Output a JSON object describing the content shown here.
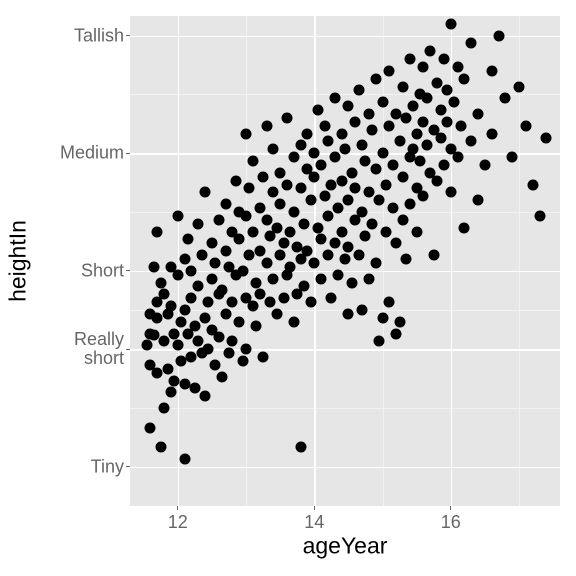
{
  "chart_data": {
    "type": "scatter",
    "title": "",
    "xlabel": "ageYear",
    "ylabel": "heightIn",
    "xlim": [
      11.3,
      17.6
    ],
    "ylim": [
      48,
      73
    ],
    "x_ticks": [
      12,
      14,
      16
    ],
    "y_ticks": [
      {
        "value": 50,
        "label": "Tiny"
      },
      {
        "value": 56,
        "label": "Really\nshort"
      },
      {
        "value": 60,
        "label": "Short"
      },
      {
        "value": 66,
        "label": "Medium"
      },
      {
        "value": 72,
        "label": "Tallish"
      }
    ],
    "series": [
      {
        "name": "heightIn",
        "data": [
          [
            11.55,
            56.2
          ],
          [
            11.6,
            57.8
          ],
          [
            11.6,
            56.8
          ],
          [
            11.6,
            55.2
          ],
          [
            11.6,
            52.0
          ],
          [
            11.65,
            60.2
          ],
          [
            11.65,
            56.7
          ],
          [
            11.7,
            54.8
          ],
          [
            11.7,
            58.4
          ],
          [
            11.7,
            62.0
          ],
          [
            11.7,
            57.6
          ],
          [
            11.75,
            51.0
          ],
          [
            11.75,
            59.4
          ],
          [
            11.8,
            53.0
          ],
          [
            11.8,
            58.8
          ],
          [
            11.8,
            56.4
          ],
          [
            11.85,
            57.8
          ],
          [
            11.85,
            55.0
          ],
          [
            11.9,
            60.2
          ],
          [
            11.9,
            53.8
          ],
          [
            11.9,
            58.2
          ],
          [
            11.95,
            56.8
          ],
          [
            11.95,
            54.4
          ],
          [
            12.0,
            59.8
          ],
          [
            12.0,
            62.8
          ],
          [
            12.0,
            56.2
          ],
          [
            12.05,
            57.4
          ],
          [
            12.05,
            55.4
          ],
          [
            12.1,
            60.6
          ],
          [
            12.1,
            54.2
          ],
          [
            12.1,
            58.0
          ],
          [
            12.1,
            50.4
          ],
          [
            12.15,
            56.8
          ],
          [
            12.15,
            61.6
          ],
          [
            12.2,
            55.6
          ],
          [
            12.2,
            58.6
          ],
          [
            12.2,
            60.0
          ],
          [
            12.25,
            54.0
          ],
          [
            12.25,
            57.2
          ],
          [
            12.3,
            62.4
          ],
          [
            12.3,
            56.4
          ],
          [
            12.3,
            59.2
          ],
          [
            12.35,
            55.8
          ],
          [
            12.35,
            60.8
          ],
          [
            12.4,
            57.6
          ],
          [
            12.4,
            53.6
          ],
          [
            12.4,
            64.0
          ],
          [
            12.45,
            58.4
          ],
          [
            12.45,
            56.0
          ],
          [
            12.5,
            61.4
          ],
          [
            12.5,
            59.6
          ],
          [
            12.5,
            57.0
          ],
          [
            12.55,
            55.2
          ],
          [
            12.55,
            60.4
          ],
          [
            12.6,
            58.8
          ],
          [
            12.6,
            62.6
          ],
          [
            12.6,
            56.6
          ],
          [
            12.65,
            59.0
          ],
          [
            12.65,
            54.6
          ],
          [
            12.7,
            61.0
          ],
          [
            12.7,
            57.8
          ],
          [
            12.7,
            63.4
          ],
          [
            12.75,
            60.2
          ],
          [
            12.75,
            55.8
          ],
          [
            12.8,
            58.4
          ],
          [
            12.8,
            62.0
          ],
          [
            12.8,
            56.4
          ],
          [
            12.85,
            59.8
          ],
          [
            12.85,
            64.6
          ],
          [
            12.9,
            57.4
          ],
          [
            12.9,
            61.6
          ],
          [
            12.9,
            63.0
          ],
          [
            12.95,
            55.4
          ],
          [
            12.95,
            60.0
          ],
          [
            13.0,
            67.0
          ],
          [
            13.0,
            58.6
          ],
          [
            13.0,
            62.8
          ],
          [
            13.0,
            56.0
          ],
          [
            13.05,
            60.8
          ],
          [
            13.05,
            64.2
          ],
          [
            13.1,
            58.2
          ],
          [
            13.1,
            62.0
          ],
          [
            13.1,
            65.6
          ],
          [
            13.15,
            59.4
          ],
          [
            13.15,
            57.2
          ],
          [
            13.2,
            63.2
          ],
          [
            13.2,
            61.0
          ],
          [
            13.2,
            58.8
          ],
          [
            13.25,
            55.6
          ],
          [
            13.25,
            64.8
          ],
          [
            13.3,
            60.4
          ],
          [
            13.3,
            62.6
          ],
          [
            13.3,
            67.4
          ],
          [
            13.35,
            58.4
          ],
          [
            13.35,
            61.8
          ],
          [
            13.4,
            64.0
          ],
          [
            13.4,
            59.6
          ],
          [
            13.4,
            66.2
          ],
          [
            13.45,
            62.2
          ],
          [
            13.45,
            57.8
          ],
          [
            13.5,
            60.8
          ],
          [
            13.5,
            65.0
          ],
          [
            13.5,
            63.4
          ],
          [
            13.55,
            58.6
          ],
          [
            13.55,
            61.4
          ],
          [
            13.6,
            67.8
          ],
          [
            13.6,
            59.8
          ],
          [
            13.6,
            64.4
          ],
          [
            13.65,
            62.0
          ],
          [
            13.65,
            60.2
          ],
          [
            13.7,
            65.8
          ],
          [
            13.7,
            63.0
          ],
          [
            13.7,
            57.4
          ],
          [
            13.75,
            61.2
          ],
          [
            13.75,
            58.8
          ],
          [
            13.8,
            66.4
          ],
          [
            13.8,
            60.6
          ],
          [
            13.8,
            64.2
          ],
          [
            13.8,
            51.0
          ],
          [
            13.85,
            62.4
          ],
          [
            13.85,
            59.2
          ],
          [
            13.9,
            65.2
          ],
          [
            13.9,
            67.0
          ],
          [
            13.9,
            61.0
          ],
          [
            13.95,
            63.6
          ],
          [
            13.95,
            58.4
          ],
          [
            14.0,
            66.0
          ],
          [
            14.0,
            60.4
          ],
          [
            14.0,
            64.8
          ],
          [
            14.05,
            62.2
          ],
          [
            14.05,
            68.2
          ],
          [
            14.1,
            59.6
          ],
          [
            14.1,
            65.4
          ],
          [
            14.1,
            61.6
          ],
          [
            14.15,
            63.8
          ],
          [
            14.15,
            67.4
          ],
          [
            14.2,
            60.8
          ],
          [
            14.2,
            66.6
          ],
          [
            14.2,
            62.8
          ],
          [
            14.25,
            58.6
          ],
          [
            14.25,
            64.4
          ],
          [
            14.3,
            68.8
          ],
          [
            14.3,
            61.4
          ],
          [
            14.3,
            65.8
          ],
          [
            14.35,
            63.2
          ],
          [
            14.35,
            59.8
          ],
          [
            14.4,
            67.0
          ],
          [
            14.4,
            62.0
          ],
          [
            14.4,
            64.6
          ],
          [
            14.45,
            60.6
          ],
          [
            14.45,
            66.2
          ],
          [
            14.5,
            68.4
          ],
          [
            14.5,
            63.6
          ],
          [
            14.5,
            57.8
          ],
          [
            14.5,
            61.2
          ],
          [
            14.55,
            65.0
          ],
          [
            14.55,
            59.4
          ],
          [
            14.6,
            67.6
          ],
          [
            14.6,
            62.6
          ],
          [
            14.6,
            64.2
          ],
          [
            14.65,
            60.8
          ],
          [
            14.65,
            69.2
          ],
          [
            14.7,
            66.4
          ],
          [
            14.7,
            63.0
          ],
          [
            14.7,
            58.0
          ],
          [
            14.75,
            65.6
          ],
          [
            14.75,
            61.8
          ],
          [
            14.8,
            68.0
          ],
          [
            14.8,
            64.0
          ],
          [
            14.8,
            59.6
          ],
          [
            14.85,
            67.2
          ],
          [
            14.85,
            62.4
          ],
          [
            14.9,
            65.2
          ],
          [
            14.9,
            60.4
          ],
          [
            14.9,
            69.8
          ],
          [
            14.95,
            63.6
          ],
          [
            14.95,
            56.4
          ],
          [
            15.0,
            57.6
          ],
          [
            15.0,
            66.0
          ],
          [
            15.0,
            68.6
          ],
          [
            15.05,
            64.4
          ],
          [
            15.05,
            62.0
          ],
          [
            15.1,
            67.4
          ],
          [
            15.1,
            58.4
          ],
          [
            15.1,
            70.2
          ],
          [
            15.15,
            65.4
          ],
          [
            15.15,
            63.2
          ],
          [
            15.2,
            56.8
          ],
          [
            15.2,
            68.0
          ],
          [
            15.2,
            61.4
          ],
          [
            15.25,
            66.6
          ],
          [
            15.25,
            57.4
          ],
          [
            15.3,
            69.4
          ],
          [
            15.3,
            64.8
          ],
          [
            15.3,
            62.6
          ],
          [
            15.35,
            67.8
          ],
          [
            15.35,
            60.6
          ],
          [
            15.4,
            65.8
          ],
          [
            15.4,
            70.8
          ],
          [
            15.4,
            63.4
          ],
          [
            15.45,
            68.4
          ],
          [
            15.45,
            66.2
          ],
          [
            15.5,
            62.0
          ],
          [
            15.5,
            67.0
          ],
          [
            15.5,
            64.2
          ],
          [
            15.55,
            69.0
          ],
          [
            15.55,
            65.6
          ],
          [
            15.6,
            67.6
          ],
          [
            15.6,
            70.4
          ],
          [
            15.6,
            63.8
          ],
          [
            15.65,
            66.4
          ],
          [
            15.65,
            68.8
          ],
          [
            15.7,
            65.0
          ],
          [
            15.7,
            71.2
          ],
          [
            15.75,
            67.2
          ],
          [
            15.75,
            60.8
          ],
          [
            15.8,
            69.6
          ],
          [
            15.8,
            64.6
          ],
          [
            15.85,
            66.8
          ],
          [
            15.85,
            68.2
          ],
          [
            15.9,
            65.4
          ],
          [
            15.9,
            70.8
          ],
          [
            15.95,
            67.6
          ],
          [
            15.95,
            69.2
          ],
          [
            16.0,
            72.6
          ],
          [
            16.0,
            66.2
          ],
          [
            16.0,
            64.0
          ],
          [
            16.05,
            68.6
          ],
          [
            16.1,
            70.4
          ],
          [
            16.1,
            65.8
          ],
          [
            16.15,
            67.4
          ],
          [
            16.2,
            62.2
          ],
          [
            16.2,
            69.8
          ],
          [
            16.3,
            66.6
          ],
          [
            16.3,
            71.6
          ],
          [
            16.4,
            68.0
          ],
          [
            16.4,
            63.6
          ],
          [
            16.5,
            65.4
          ],
          [
            16.6,
            70.2
          ],
          [
            16.6,
            67.0
          ],
          [
            16.7,
            72.0
          ],
          [
            16.8,
            68.8
          ],
          [
            16.9,
            65.8
          ],
          [
            17.0,
            69.4
          ],
          [
            17.1,
            67.4
          ],
          [
            17.2,
            64.4
          ],
          [
            17.3,
            62.8
          ],
          [
            17.4,
            66.8
          ]
        ]
      }
    ]
  }
}
